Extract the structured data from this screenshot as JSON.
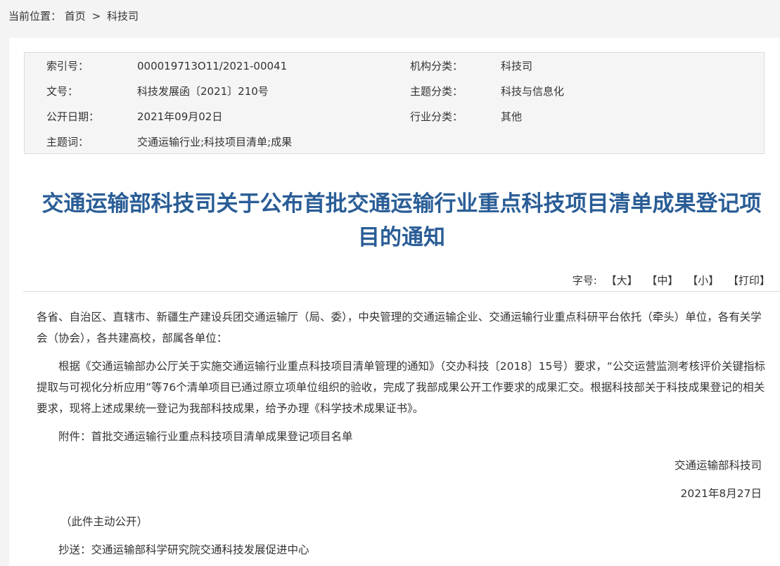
{
  "breadcrumb": {
    "prefix": "当前位置：",
    "items": [
      "首页",
      "科技司"
    ],
    "separator": ">"
  },
  "meta": {
    "rows": [
      {
        "label1": "索引号：",
        "value1": "000019713O11/2021-00041",
        "label2": "机构分类：",
        "value2": "科技司"
      },
      {
        "label1": "文号：",
        "value1": "科技发展函〔2021〕210号",
        "label2": "主题分类：",
        "value2": "科技与信息化"
      },
      {
        "label1": "公开日期：",
        "value1": "2021年09月02日",
        "label2": "行业分类：",
        "value2": "其他"
      },
      {
        "label1": "主题词：",
        "value1": "交通运输行业;科技项目清单;成果",
        "label2": "",
        "value2": ""
      }
    ]
  },
  "article": {
    "title_line1": "交通运输部科技司关于公布首批交通运输行业重点科技项目清单成果登记项",
    "title_line2": "目的通知",
    "fontsize_label": "字号:",
    "fontsize_large": "【大】",
    "fontsize_medium": "【中】",
    "fontsize_small": "【小】",
    "print": "【打印】",
    "salutation": "各省、自治区、直辖市、新疆生产建设兵团交通运输厅（局、委），中央管理的交通运输企业、交通运输行业重点科研平台依托（牵头）单位，各有关学会（协会），各共建高校，部属各单位：",
    "main_paragraph": "根据《交通运输部办公厅关于实施交通运输行业重点科技项目清单管理的通知》（交办科技〔2018〕15号）要求，“公交运营监测考核评价关键指标提取与可视化分析应用”等76个清单项目已通过原立项单位组织的验收，完成了我部成果公开工作要求的成果汇交。根据科技部关于科技成果登记的相关要求，现将上述成果统一登记为我部科技成果，给予办理《科学技术成果证书》。",
    "attachment": "附件：首批交通运输行业重点科技项目清单成果登记项目名单",
    "signature": "交通运输部科技司",
    "date": "2021年8月27日",
    "public_note": "（此件主动公开）",
    "cc": "抄送：交通运输部科学研究院交通科技发展促进中心"
  },
  "colors": {
    "title": "#2a5d96",
    "meta_bg": "#f5f5f5",
    "page_bg": "#f4f4f4"
  }
}
